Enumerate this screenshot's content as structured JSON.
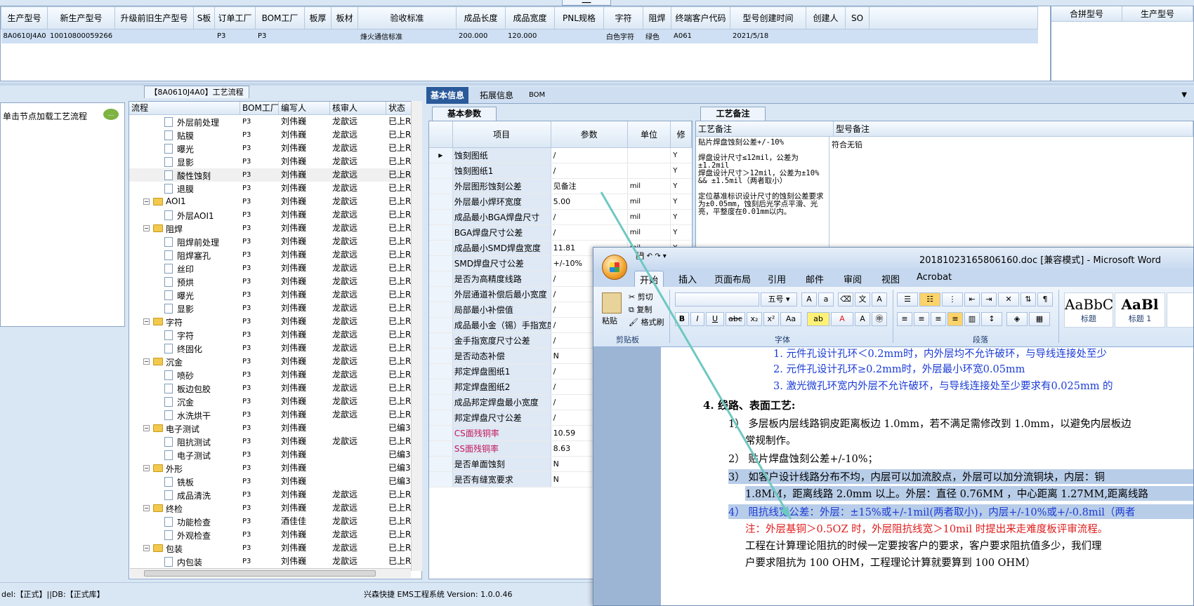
{
  "top_grid": {
    "columns": [
      "生产型号",
      "新生产型号",
      "升级前旧生产型号",
      "S板",
      "订单工厂",
      "BOM工厂",
      "板厚",
      "板材",
      "验收标准",
      "成品长度",
      "成品宽度",
      "PNL规格",
      "字符",
      "阻焊",
      "终端客户代码",
      "型号创建时间",
      "创建人",
      "SO"
    ],
    "row": [
      "8A0610J4A0",
      "10010800059266",
      "",
      "",
      "P3",
      "P3",
      "",
      "",
      "烽火通信标准",
      "200.000",
      "120.000",
      "",
      "白色字符",
      "绿色",
      "A061",
      "2021/5/18",
      "",
      ""
    ]
  },
  "right_grid": {
    "columns": [
      "合拼型号",
      "生产型号"
    ]
  },
  "top_handle": "━━━",
  "left_panel": {
    "hint": "单击节点加载工艺流程"
  },
  "tree": {
    "title": "【8A0610J4A0】工艺流程",
    "columns": [
      "流程",
      "BOM工厂",
      "编写人",
      "核审人",
      "状态"
    ],
    "rows": [
      {
        "label": "外层前处理",
        "kind": "leaf",
        "bom": "P3",
        "writer": "刘伟巍",
        "reviewer": "龙歆远",
        "status": "已上R"
      },
      {
        "label": "贴膜",
        "kind": "leaf",
        "bom": "P3",
        "writer": "刘伟巍",
        "reviewer": "龙歆远",
        "status": "已上R"
      },
      {
        "label": "曝光",
        "kind": "leaf",
        "bom": "P3",
        "writer": "刘伟巍",
        "reviewer": "龙歆远",
        "status": "已上R"
      },
      {
        "label": "显影",
        "kind": "leaf",
        "bom": "P3",
        "writer": "刘伟巍",
        "reviewer": "龙歆远",
        "status": "已上R"
      },
      {
        "label": "酸性蚀刻",
        "kind": "leaf",
        "bom": "P3",
        "writer": "刘伟巍",
        "reviewer": "龙歆远",
        "status": "已上R",
        "selected": true
      },
      {
        "label": "退膜",
        "kind": "leaf",
        "bom": "P3",
        "writer": "刘伟巍",
        "reviewer": "龙歆远",
        "status": "已上R"
      },
      {
        "label": "AOI1",
        "kind": "folder",
        "bom": "P3",
        "writer": "刘伟巍",
        "reviewer": "龙歆远",
        "status": "已上R"
      },
      {
        "label": "外层AOI1",
        "kind": "leaf",
        "bom": "P3",
        "writer": "刘伟巍",
        "reviewer": "龙歆远",
        "status": "已上R"
      },
      {
        "label": "阻焊",
        "kind": "folder",
        "bom": "P3",
        "writer": "刘伟巍",
        "reviewer": "龙歆远",
        "status": "已上R"
      },
      {
        "label": "阻焊前处理",
        "kind": "leaf",
        "bom": "P3",
        "writer": "刘伟巍",
        "reviewer": "龙歆远",
        "status": "已上R"
      },
      {
        "label": "阻焊塞孔",
        "kind": "leaf",
        "bom": "P3",
        "writer": "刘伟巍",
        "reviewer": "龙歆远",
        "status": "已上R"
      },
      {
        "label": "丝印",
        "kind": "leaf",
        "bom": "P3",
        "writer": "刘伟巍",
        "reviewer": "龙歆远",
        "status": "已上R"
      },
      {
        "label": "预烘",
        "kind": "leaf",
        "bom": "P3",
        "writer": "刘伟巍",
        "reviewer": "龙歆远",
        "status": "已上R"
      },
      {
        "label": "曝光",
        "kind": "leaf",
        "bom": "P3",
        "writer": "刘伟巍",
        "reviewer": "龙歆远",
        "status": "已上R"
      },
      {
        "label": "显影",
        "kind": "leaf",
        "bom": "P3",
        "writer": "刘伟巍",
        "reviewer": "龙歆远",
        "status": "已上R"
      },
      {
        "label": "字符",
        "kind": "folder",
        "bom": "P3",
        "writer": "刘伟巍",
        "reviewer": "龙歆远",
        "status": "已上R"
      },
      {
        "label": "字符",
        "kind": "leaf",
        "bom": "P3",
        "writer": "刘伟巍",
        "reviewer": "龙歆远",
        "status": "已上R"
      },
      {
        "label": "终固化",
        "kind": "leaf",
        "bom": "P3",
        "writer": "刘伟巍",
        "reviewer": "龙歆远",
        "status": "已上R"
      },
      {
        "label": "沉金",
        "kind": "folder",
        "bom": "P3",
        "writer": "刘伟巍",
        "reviewer": "龙歆远",
        "status": "已上R"
      },
      {
        "label": "喷砂",
        "kind": "leaf",
        "bom": "P3",
        "writer": "刘伟巍",
        "reviewer": "龙歆远",
        "status": "已上R"
      },
      {
        "label": "板边包胶",
        "kind": "leaf",
        "bom": "P3",
        "writer": "刘伟巍",
        "reviewer": "龙歆远",
        "status": "已上R"
      },
      {
        "label": "沉金",
        "kind": "leaf",
        "bom": "P3",
        "writer": "刘伟巍",
        "reviewer": "龙歆远",
        "status": "已上R"
      },
      {
        "label": "水洗烘干",
        "kind": "leaf",
        "bom": "P3",
        "writer": "刘伟巍",
        "reviewer": "龙歆远",
        "status": "已上R"
      },
      {
        "label": "电子测试",
        "kind": "folder",
        "bom": "P3",
        "writer": "刘伟巍",
        "reviewer": "",
        "status": "已编3"
      },
      {
        "label": "阻抗测试",
        "kind": "leaf",
        "bom": "P3",
        "writer": "刘伟巍",
        "reviewer": "龙歆远",
        "status": "已上R"
      },
      {
        "label": "电子测试",
        "kind": "leaf",
        "bom": "P3",
        "writer": "刘伟巍",
        "reviewer": "",
        "status": "已编3"
      },
      {
        "label": "外形",
        "kind": "folder",
        "bom": "P3",
        "writer": "刘伟巍",
        "reviewer": "",
        "status": "已编3"
      },
      {
        "label": "铣板",
        "kind": "leaf",
        "bom": "P3",
        "writer": "刘伟巍",
        "reviewer": "",
        "status": "已编3"
      },
      {
        "label": "成品清洗",
        "kind": "leaf",
        "bom": "P3",
        "writer": "刘伟巍",
        "reviewer": "龙歆远",
        "status": "已上R"
      },
      {
        "label": "终检",
        "kind": "folder",
        "bom": "P3",
        "writer": "刘伟巍",
        "reviewer": "龙歆远",
        "status": "已上R"
      },
      {
        "label": "功能检查",
        "kind": "leaf",
        "bom": "P3",
        "writer": "酒佳佳",
        "reviewer": "龙歆远",
        "status": "已上R"
      },
      {
        "label": "外观检查",
        "kind": "leaf",
        "bom": "P3",
        "writer": "刘伟巍",
        "reviewer": "龙歆远",
        "status": "已上R"
      },
      {
        "label": "包装",
        "kind": "folder",
        "bom": "P3",
        "writer": "刘伟巍",
        "reviewer": "龙歆远",
        "status": "已上R"
      },
      {
        "label": "内包装",
        "kind": "leaf",
        "bom": "P3",
        "writer": "刘伟巍",
        "reviewer": "龙歆远",
        "status": "已上R"
      }
    ]
  },
  "info_tabs": [
    "基本信息",
    "拓展信息",
    "BOM"
  ],
  "basic_params": {
    "subtab": "基本参数",
    "columns": [
      "项目",
      "参数",
      "单位",
      "修"
    ],
    "rows": [
      {
        "name": "蚀刻图纸",
        "value": "/",
        "unit": "",
        "mod": "Y",
        "current": true
      },
      {
        "name": "蚀刻图纸1",
        "value": "/",
        "unit": "",
        "mod": "Y"
      },
      {
        "name": "外层图形蚀刻公差",
        "value": "见备注",
        "unit": "mil",
        "mod": "Y"
      },
      {
        "name": "外层最小焊环宽度",
        "value": "5.00",
        "unit": "mil",
        "mod": "Y"
      },
      {
        "name": "成品最小BGA焊盘尺寸",
        "value": "/",
        "unit": "mil",
        "mod": "Y"
      },
      {
        "name": "BGA焊盘尺寸公差",
        "value": "/",
        "unit": "mil",
        "mod": "Y"
      },
      {
        "name": "成品最小SMD焊盘宽度",
        "value": "11.81",
        "unit": "mil",
        "mod": "Y"
      },
      {
        "name": "SMD焊盘尺寸公差",
        "value": "+/-10%",
        "unit": "",
        "mod": ""
      },
      {
        "name": "是否为高精度线路",
        "value": "/",
        "unit": "",
        "mod": ""
      },
      {
        "name": "外层通道补偿后最小宽度",
        "value": "/",
        "unit": "",
        "mod": ""
      },
      {
        "name": "局部最小补偿值",
        "value": "/",
        "unit": "",
        "mod": ""
      },
      {
        "name": "成品最小金（锡）手指宽度",
        "value": "/",
        "unit": "",
        "mod": ""
      },
      {
        "name": "金手指宽度尺寸公差",
        "value": "/",
        "unit": "",
        "mod": ""
      },
      {
        "name": "是否动态补偿",
        "value": "N",
        "unit": "",
        "mod": ""
      },
      {
        "name": "邦定焊盘图纸1",
        "value": "/",
        "unit": "",
        "mod": ""
      },
      {
        "name": "邦定焊盘图纸2",
        "value": "/",
        "unit": "",
        "mod": ""
      },
      {
        "name": "成品邦定焊盘最小宽度",
        "value": "/",
        "unit": "",
        "mod": ""
      },
      {
        "name": "邦定焊盘尺寸公差",
        "value": "/",
        "unit": "",
        "mod": ""
      },
      {
        "name": "CS面残铜率",
        "value": "10.59",
        "unit": "",
        "mod": "",
        "red": true
      },
      {
        "name": "SS面残铜率",
        "value": "8.63",
        "unit": "",
        "mod": "",
        "red": true
      },
      {
        "name": "是否单面蚀刻",
        "value": "N",
        "unit": "",
        "mod": ""
      },
      {
        "name": "是否有缝宽要求",
        "value": "N",
        "unit": "",
        "mod": ""
      }
    ]
  },
  "craft_notes": {
    "subtab": "工艺备注",
    "columns": [
      "工艺备注",
      "型号备注"
    ],
    "craft_text": "贴片焊盘蚀刻公差+/-10%\n\n焊盘设计尺寸≤12mil，公差为±1.2mil\n焊盘设计尺寸＞12mil，公差为±10% && ±1.5mil（两者取小）\n\n定位基准标识设计尺寸的蚀刻公差要求为±0.05mm，蚀刻后光学点平滑、光亮，平整度在0.01mm以内。",
    "model_text": "符合无铅"
  },
  "status_bar": {
    "left": "del:【正式】||DB:【正式库】",
    "center": "兴森快捷 EMS工程系统 Version: 1.0.0.46"
  },
  "word": {
    "title": "20181023165806160.doc [兼容模式] - Microsoft Word",
    "tabs": [
      "开始",
      "插入",
      "页面布局",
      "引用",
      "邮件",
      "审阅",
      "视图",
      "Acrobat"
    ],
    "groups": {
      "clipboard": "剪贴板",
      "font": "字体",
      "paragraph": "段落"
    },
    "clipboard": {
      "paste": "粘贴",
      "cut": "剪切",
      "copy": "复制",
      "format_painter": "格式刷"
    },
    "font_size": "五号",
    "styles": [
      {
        "preview": "AaBbC",
        "name": "标题"
      },
      {
        "preview": "AaBl",
        "name": "标题 1"
      }
    ],
    "doc": {
      "line1": "1.   元件孔设计孔环＜0.2mm时，内外层均不允许破环，与导线连接处至少",
      "line2": "2.   元件孔设计孔环≥0.2mm时，外层最小环宽0.05mm",
      "line3": "3.   激光微孔环宽内外层不允许破环，与导线连接处至少要求有0.025mm 的",
      "heading": "4.   线路、表面工艺:",
      "p1a": "1）  多层板内层线路铜皮距离板边 1.0mm，若不满足需修改到 1.0mm，以避免内层板边",
      "p1b": "常规制作。",
      "p2": "2）  贴片焊盘蚀刻公差+/-10%；",
      "p3a": "3）  如客户设计线路分布不均，内层可以加流胶点，外层可以加分流铜块，内层：铜",
      "p3b": "1.8MM，距离线路 2.0mm 以上。外层：直径 0.76MM ，中心距离 1.27MM,距离线路",
      "p4a": "4）  阻抗线宽公差：外层：±15%或+/-1mil(两者取小)，内层+/-10%或+/-0.8mil（两者",
      "p4b": "注：外层基铜＞0.5OZ 时，外层阻抗线宽＞10mil 时提出来走难度板评审流程。",
      "p4c": "工程在计算理论阻抗的时候一定要按客户的要求，客户要求阻抗值多少，我们理",
      "p4d": "户要求阻抗为 100 OHM，工程理论计算就要算到 100  OHM）"
    }
  },
  "colors": {
    "accent": "#2a5a9a",
    "row_highlight": "#cfe0f4",
    "doc_blue": "#1a3bd6",
    "doc_red": "#e01b1b",
    "arrow": "#6ec8c0"
  }
}
